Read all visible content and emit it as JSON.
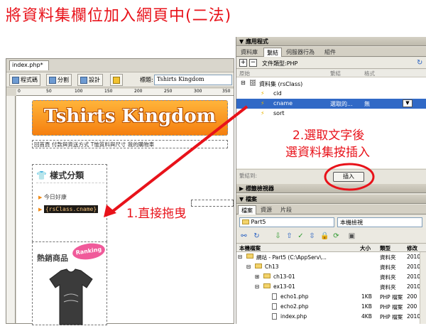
{
  "page_title": "將資料集欄位加入網頁中(二法)",
  "doc": {
    "tab": "index.php*",
    "toolbar": {
      "code": "程式碼",
      "split": "分割",
      "design": "設計",
      "title_label": "標題:",
      "title_value": "Tshirts Kingdom"
    },
    "ruler": [
      "0",
      "50",
      "100",
      "150",
      "200",
      "250",
      "300",
      "350"
    ],
    "logo": "Tshirts Kingdom",
    "nav": "回首頁 付款與貨送方式 T恤質料與尺寸 我的購物車",
    "category_title": "樣式分類",
    "category_item": "今日好康",
    "dragged_field": "{rsClass.cname}",
    "hot_title": "熱銷商品",
    "ranking": "Ranking"
  },
  "panel": {
    "app_title": "應用程式",
    "tabs": [
      "資料庫",
      "繫結",
      "伺服器行為",
      "組件"
    ],
    "doctype": "文件類型:PHP",
    "col_source": "原始",
    "col_binding": "繫結",
    "col_format": "格式",
    "recordset": "資料集 (rsClass)",
    "fields": [
      "cid",
      "cname",
      "sort"
    ],
    "selected_binding": "選取的...",
    "selected_format": "無",
    "bind_to": "繫結到:",
    "insert": "插入",
    "tag_inspector": "標籤檢視器",
    "files_title": "檔案",
    "files_tabs": [
      "檔案",
      "資源",
      "片段"
    ],
    "site": "Part5",
    "view": "本機檢視",
    "file_headers": [
      "本機檔案",
      "大小",
      "類型",
      "修改"
    ],
    "files": [
      {
        "name": "網站 - Part5 (C:\\AppServ\\...",
        "size": "",
        "type": "資料夾",
        "mod": "2010"
      },
      {
        "name": "Ch13",
        "size": "",
        "type": "資料夾",
        "mod": "2010"
      },
      {
        "name": "ch13-01",
        "size": "",
        "type": "資料夾",
        "mod": "2010"
      },
      {
        "name": "ex13-01",
        "size": "",
        "type": "資料夾",
        "mod": "2010"
      },
      {
        "name": "echo1.php",
        "size": "1KB",
        "type": "PHP 檔案",
        "mod": "200"
      },
      {
        "name": "echo2.php",
        "size": "1KB",
        "type": "PHP 檔案",
        "mod": "200"
      },
      {
        "name": "index.php",
        "size": "4KB",
        "type": "PHP 檔案",
        "mod": "2010"
      }
    ]
  },
  "notes": {
    "step1": "1.直接拖曳",
    "step2_line1": "2.選取文字後",
    "step2_line2": "選資料集按插入"
  },
  "colors": {
    "accent_red": "#e8121a",
    "selection_blue": "#3169c6",
    "orange": "#f57f0f"
  }
}
